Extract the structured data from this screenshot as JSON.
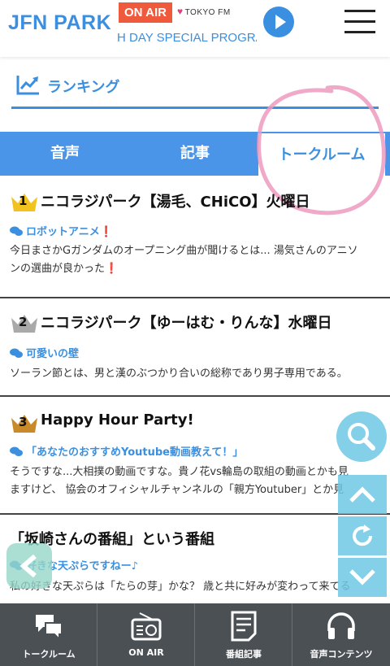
{
  "header": {
    "logo": "JFN PARK",
    "onair_badge": "ON AIR",
    "station_logo": "TOKYO FM",
    "station_heart": "♥",
    "ticker": "H DAY SPECIAL PROGRAM"
  },
  "ranking": {
    "label": "ランキング",
    "icon": "trend-chart-icon"
  },
  "tabs": [
    {
      "label": "音声",
      "active": false
    },
    {
      "label": "記事",
      "active": false
    },
    {
      "label": "トークルーム",
      "active": true
    }
  ],
  "items": [
    {
      "rank": "1",
      "crown_color": "#f2c21f",
      "title": "ニコラジパーク【湯毛、CHiCO】火曜日",
      "category": "ロボットアニメ",
      "category_mark": "❗",
      "body_line1": "今日まさかGガンダムのオープニング曲が聞けるとは... 湯気さんのアニソ",
      "body_line2": "ンの選曲が良かった",
      "body_mark": "❗"
    },
    {
      "rank": "2",
      "crown_color": "#a9a9a9",
      "title": "ニコラジパーク【ゆーはむ・りんな】水曜日",
      "category": "可愛いの壁",
      "body_line1": "ソーラン節とは、男と漢のぶつかり合いの総称であり男子専用である。"
    },
    {
      "rank": "3",
      "crown_color": "#c98a2a",
      "title": "Happy Hour Party!",
      "category": "「あなたのおすすめYoutube動画教えて！」",
      "body_line1": "そうですな...大相撲の動画ですな。貴ノ花vs輪島の取組の動画とかも見",
      "body_line2": "ますけど、 協会のオフィシャルチャンネルの「親方Youtuber」とか見"
    },
    {
      "title": "「坂崎さんの番組」という番組",
      "category": "好きな天ぷらですねー♪",
      "body_line1": "私の好きな天ぷらは「たらの芽」かな？ 歳と共に好みが変わって来てる"
    }
  ],
  "bottom_nav": [
    {
      "label": "トークルーム",
      "icon": "chat-bubbles-icon"
    },
    {
      "label": "ON AIR",
      "icon": "radio-icon"
    },
    {
      "label": "番組記事",
      "icon": "article-icon"
    },
    {
      "label": "音声コンテンツ",
      "icon": "headphones-icon"
    }
  ],
  "colors": {
    "accent": "#3b8fe0",
    "onair": "#f05a3c",
    "nav_bg": "#4b5055",
    "highlight_circle": "#ee9ac0"
  }
}
